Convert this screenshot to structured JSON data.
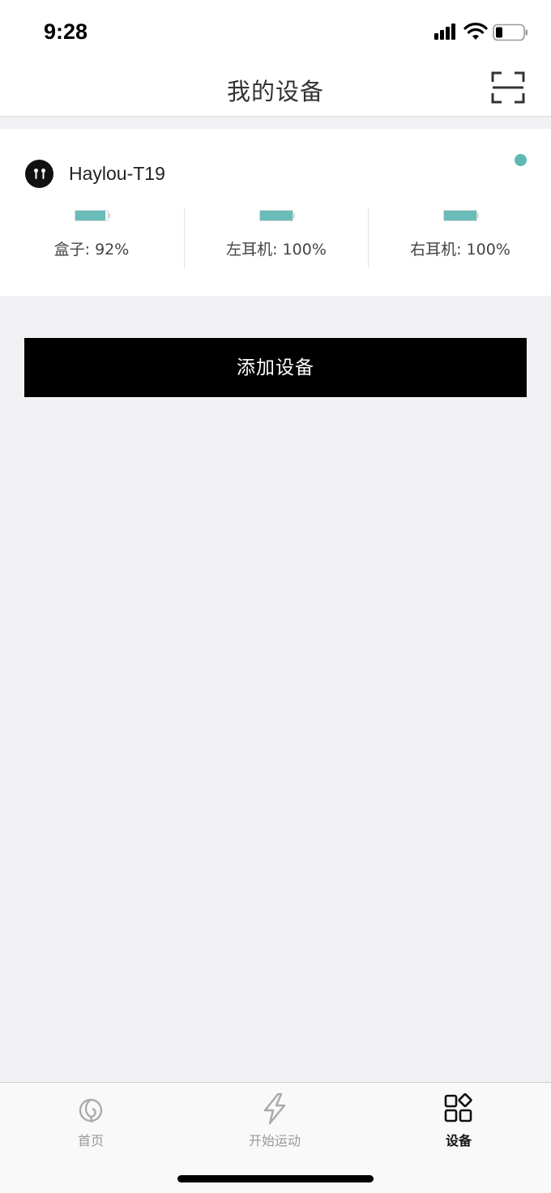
{
  "status_bar": {
    "time": "9:28"
  },
  "nav": {
    "title": "我的设备"
  },
  "device": {
    "name": "Haylou-T19",
    "connected_color": "#5fb8b5",
    "batteries": [
      {
        "label": "盒子: 92%",
        "level": 0.92
      },
      {
        "label": "左耳机: 100%",
        "level": 1.0
      },
      {
        "label": "右耳机: 100%",
        "level": 1.0
      }
    ]
  },
  "add_button": {
    "label": "添加设备"
  },
  "tabs": [
    {
      "label": "首页",
      "icon": "home-swirl-icon",
      "active": false
    },
    {
      "label": "开始运动",
      "icon": "lightning-icon",
      "active": false
    },
    {
      "label": "设备",
      "icon": "devices-grid-icon",
      "active": true
    }
  ],
  "colors": {
    "accent": "#6abcb9",
    "button_bg": "#000000",
    "page_bg": "#f1f1f3"
  }
}
